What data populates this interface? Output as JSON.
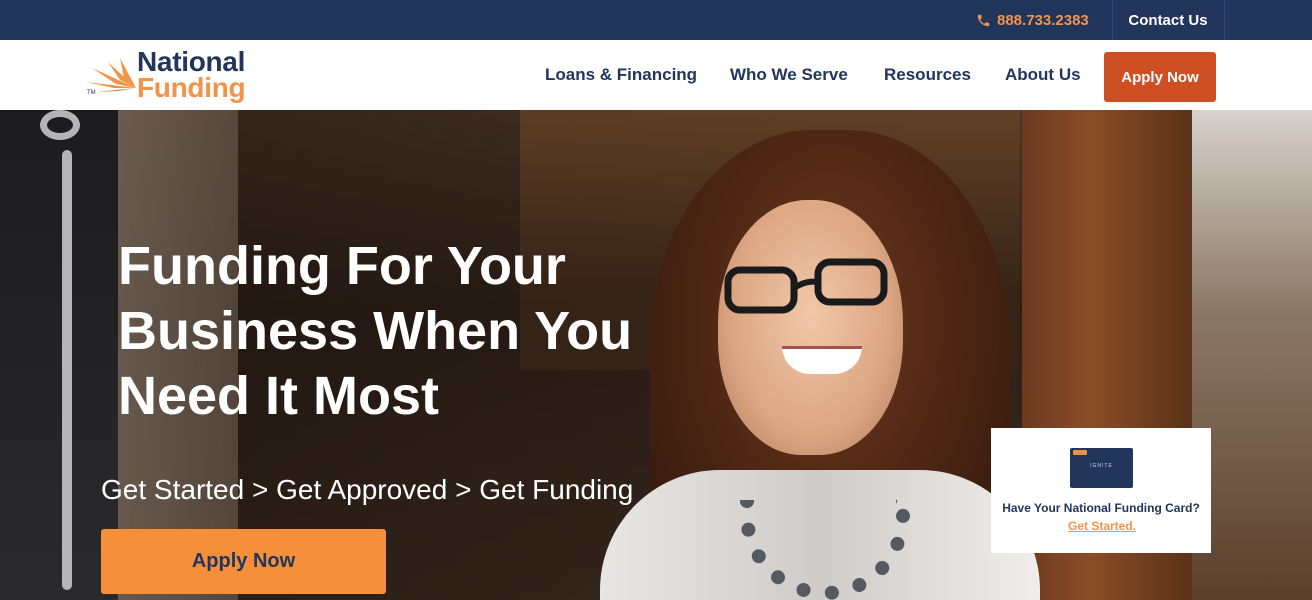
{
  "topbar": {
    "phone_icon": "phone-icon",
    "phone": "888.733.2383",
    "contact_label": "Contact Us"
  },
  "brand": {
    "logo_line1": "National",
    "logo_line2": "Funding",
    "trademark": "TM",
    "colors": {
      "navy": "#22365c",
      "orange": "#f2934a",
      "apply_red": "#cf4f25",
      "hero_button": "#f68f3a"
    }
  },
  "nav": {
    "items": [
      {
        "label": "Loans & Financing"
      },
      {
        "label": "Who We Serve"
      },
      {
        "label": "Resources"
      },
      {
        "label": "About Us"
      }
    ],
    "apply_label": "Apply Now"
  },
  "hero": {
    "headline": "Funding For Your Business When You Need It Most",
    "steps": "Get Started > Get Approved > Get Funding",
    "apply_label": "Apply Now"
  },
  "card_promo": {
    "card_word": "IGNITE",
    "text": "Have Your National Funding Card?",
    "link_label": "Get Started."
  }
}
